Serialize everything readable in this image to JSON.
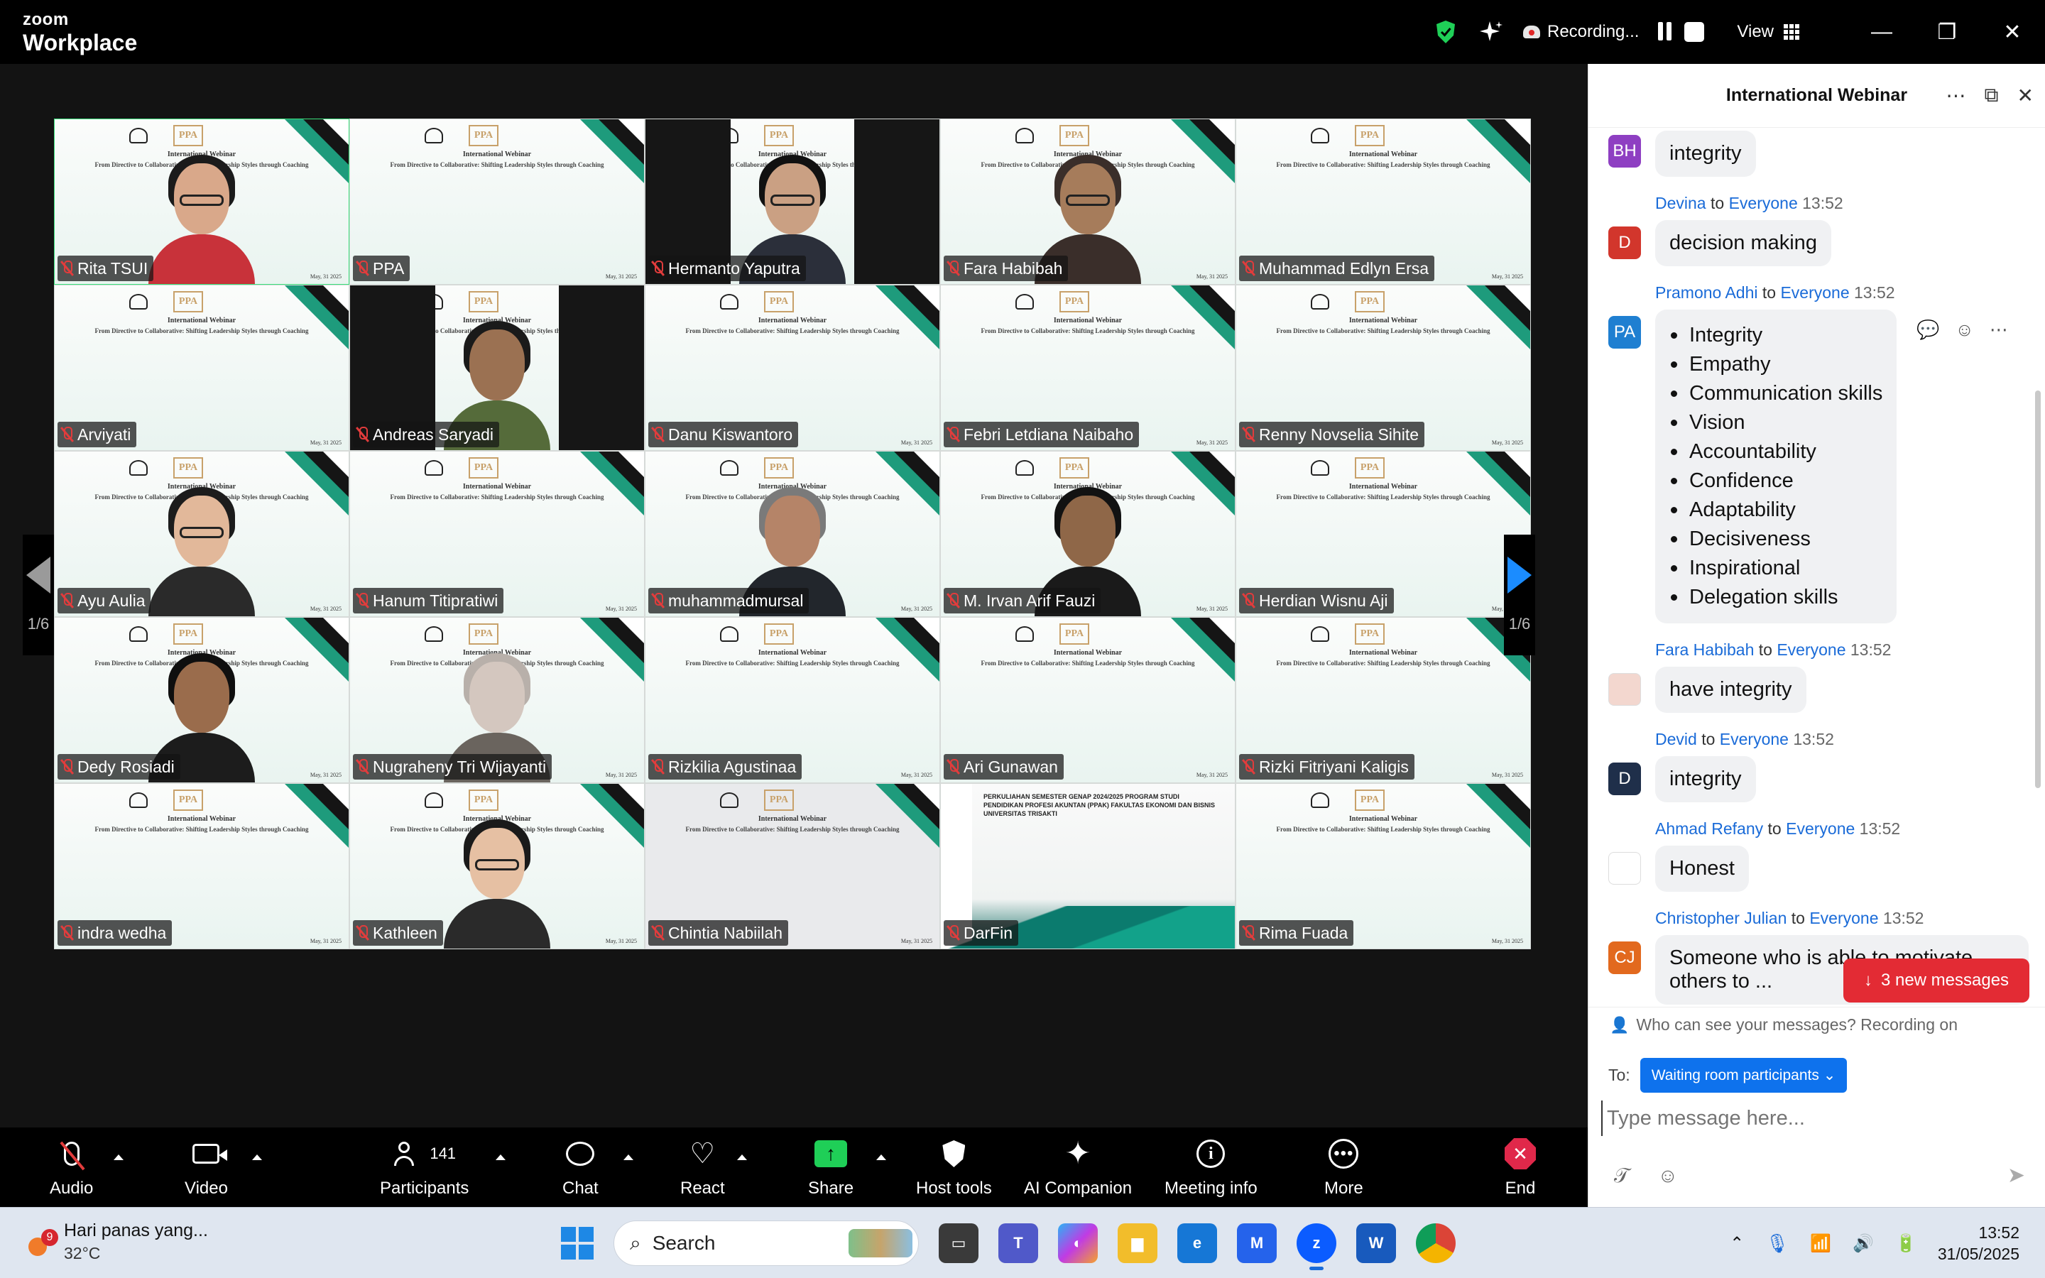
{
  "app": {
    "brand_small": "zoom",
    "brand_large": "Workplace"
  },
  "topbar": {
    "recording_label": "Recording...",
    "view_label": "View"
  },
  "gallery": {
    "page_indicator": "1/6",
    "slide_title": "International Webinar",
    "slide_subtitle": "From Directive to Collaborative: Shifting Leadership Styles through Coaching",
    "slide_date": "May, 31 2025",
    "slide_logo_text": "PPA",
    "darfin_slide_text": "PERKULIAHAN SEMESTER GENAP 2024/2025 PROGRAM STUDI PENDIDIKAN PROFESI AKUNTAN (PPAK) FAKULTAS EKONOMI DAN BISNIS UNIVERSITAS TRISAKTI",
    "tiles": [
      {
        "name": "Rita TSUI",
        "active": true,
        "video": "person",
        "skin": "#d9a88a",
        "hair": "#1b1b1b",
        "shirt": "#c8323a",
        "glasses": true
      },
      {
        "name": "PPA",
        "video": "slide"
      },
      {
        "name": "Hermanto Yaputra",
        "video": "person-bars",
        "skin": "#caa083",
        "hair": "#111",
        "shirt": "#2b2f3a",
        "glasses": true
      },
      {
        "name": "Fara Habibah",
        "video": "person",
        "skin": "#a67c5b",
        "hair": "#3a2e2a",
        "shirt": "#3a2e2a",
        "glasses": true
      },
      {
        "name": "Muhammad Edlyn Ersa",
        "video": "slide"
      },
      {
        "name": "Arviyati",
        "video": "slide"
      },
      {
        "name": "Andreas Saryadi",
        "video": "person-bars",
        "skin": "#9b7152",
        "hair": "#1a1a1a",
        "shirt": "#556b3a",
        "glasses": false
      },
      {
        "name": "Danu Kiswantoro",
        "video": "slide"
      },
      {
        "name": "Febri Letdiana Naibaho",
        "video": "slide"
      },
      {
        "name": "Renny Novselia Sihite",
        "video": "slide"
      },
      {
        "name": "Ayu Aulia",
        "video": "person",
        "skin": "#e2b89a",
        "hair": "#1c1c1c",
        "shirt": "#2a2a2a",
        "glasses": true
      },
      {
        "name": "Hanum Titipratiwi",
        "video": "slide"
      },
      {
        "name": "muhammadmursal",
        "video": "person",
        "skin": "#b58468",
        "hair": "#7a7a7a",
        "shirt": "#22262c",
        "glasses": false
      },
      {
        "name": "M. Irvan Arif Fauzi",
        "video": "person",
        "skin": "#8f6748",
        "hair": "#121212",
        "shirt": "#1a1a1a",
        "glasses": false
      },
      {
        "name": "Herdian Wisnu Aji",
        "video": "slide"
      },
      {
        "name": "Dedy Rosiadi",
        "video": "person",
        "skin": "#9a6c4c",
        "hair": "#0f0f0f",
        "shirt": "#1c1c1c",
        "glasses": false
      },
      {
        "name": "Nugraheny Tri Wijayanti",
        "video": "person",
        "skin": "#d4c7bf",
        "hair": "#b8b0aa",
        "shirt": "#6a645e",
        "glasses": false
      },
      {
        "name": "Rizkilia Agustinaa",
        "video": "slide"
      },
      {
        "name": "Ari Gunawan",
        "video": "slide"
      },
      {
        "name": "Rizki Fitriyani Kaligis",
        "video": "slide"
      },
      {
        "name": "indra wedha",
        "video": "slide"
      },
      {
        "name": "Kathleen",
        "video": "person",
        "skin": "#e6c0a3",
        "hair": "#1a1a1a",
        "shirt": "#2a2a2a",
        "glasses": true
      },
      {
        "name": "Chintia Nabiilah",
        "video": "slide-dim"
      },
      {
        "name": "DarFin",
        "video": "darfin"
      },
      {
        "name": "Rima Fuada",
        "video": "slide"
      }
    ]
  },
  "toolbar": {
    "audio": "Audio",
    "video": "Video",
    "participants": "Participants",
    "participants_count": "141",
    "chat": "Chat",
    "react": "React",
    "share": "Share",
    "host_tools": "Host tools",
    "ai_companion": "AI Companion",
    "meeting_info": "Meeting info",
    "more": "More",
    "end": "End"
  },
  "chat": {
    "title": "International Webinar",
    "to_word": "to",
    "messages": [
      {
        "initials": "BH",
        "color": "#8e3fc2",
        "sender": "",
        "recipient": "",
        "time": "",
        "text": "integrity"
      },
      {
        "initials": "D",
        "color": "#d2362c",
        "sender": "Devina",
        "recipient": "Everyone",
        "time": "13:52",
        "text": "decision making"
      },
      {
        "initials": "PA",
        "color": "#1f7fd1",
        "sender": "Pramono Adhi",
        "recipient": "Everyone",
        "time": "13:52",
        "list": [
          "Integrity",
          "Empathy",
          "Communication skills",
          "Vision",
          "Accountability",
          "Confidence",
          "Adaptability",
          "Decisiveness",
          "Inspirational",
          "Delegation skills"
        ]
      },
      {
        "initials": "",
        "color": "#f3d7cf",
        "sender": "Fara Habibah",
        "recipient": "Everyone",
        "time": "13:52",
        "text": "have integrity"
      },
      {
        "initials": "D",
        "color": "#1f2f4a",
        "sender": "Devid",
        "recipient": "Everyone",
        "time": "13:52",
        "text": "integrity"
      },
      {
        "initials": "",
        "color": "#ffffff",
        "sender": "Ahmad Refany",
        "recipient": "Everyone",
        "time": "13:52",
        "text": "Honest"
      },
      {
        "initials": "CJ",
        "color": "#e2691e",
        "sender": "Christopher Julian",
        "recipient": "Everyone",
        "time": "13:52",
        "text": "Someone who is able to motivate others to ..."
      }
    ],
    "new_messages": "3 new messages",
    "privacy": "Who can see your messages? Recording on",
    "to_label": "To:",
    "to_value": "Waiting room participants",
    "placeholder": "Type message here..."
  },
  "taskbar": {
    "weather_text": "Hari panas yang...",
    "temperature": "32°C",
    "weather_badge": "9",
    "search_label": "Search",
    "time": "13:52",
    "date": "31/05/2025"
  }
}
